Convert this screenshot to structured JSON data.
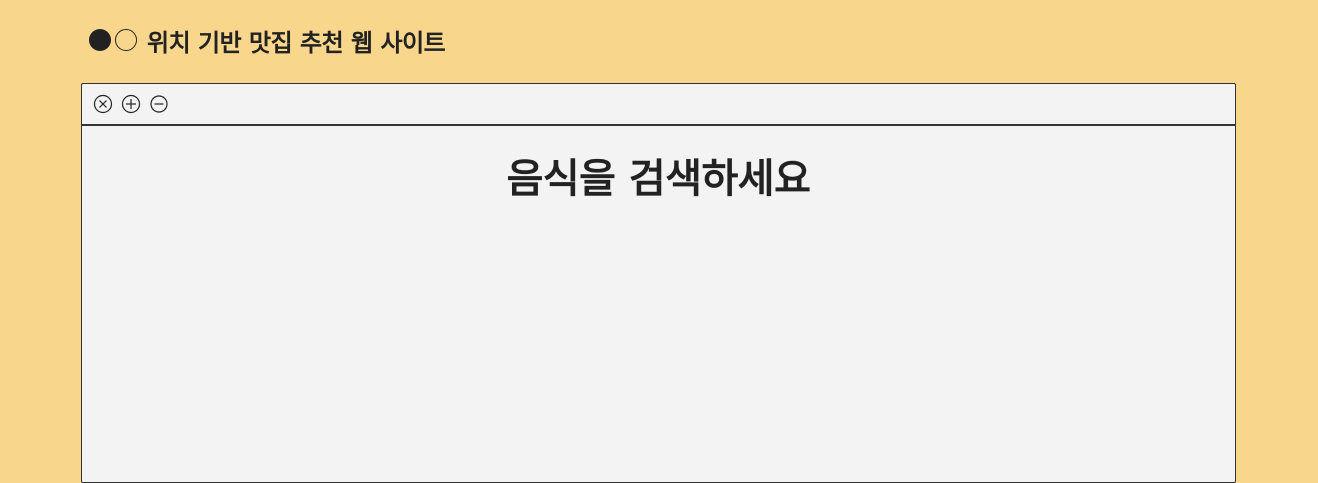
{
  "page": {
    "title": "위치 기반 맛집 추천 웹 사이트"
  },
  "window": {
    "toolbar": {
      "buttons": [
        {
          "icon": "close-circle-icon"
        },
        {
          "icon": "plus-circle-icon"
        },
        {
          "icon": "minus-circle-icon"
        }
      ]
    },
    "heading": "음식을 검색하세요"
  },
  "colors": {
    "background": "#f8d68c",
    "window_background": "#f3f3f3",
    "text": "#222222",
    "border": "#333333"
  }
}
